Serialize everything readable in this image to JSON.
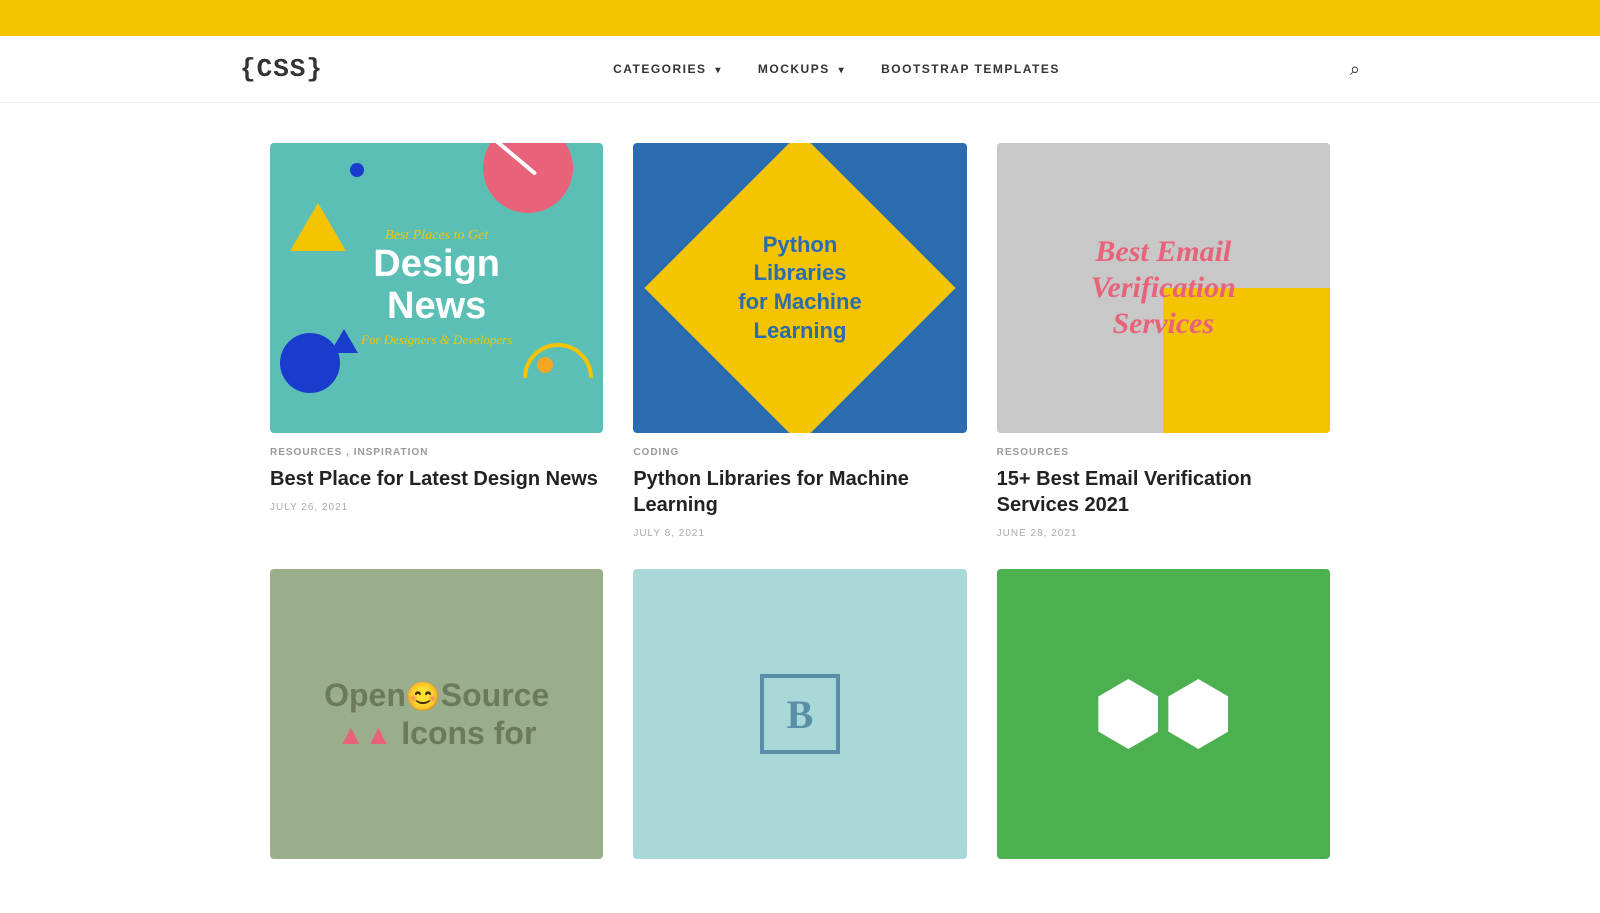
{
  "topbar": {
    "color": "#F5C400"
  },
  "navbar": {
    "logo": "{CSS}",
    "nav_items": [
      {
        "label": "CATEGORIES",
        "has_dropdown": true
      },
      {
        "label": "MOCKUPS",
        "has_dropdown": true
      },
      {
        "label": "BOOTSTRAP TEMPLATES",
        "has_dropdown": false
      }
    ],
    "search_label": "search"
  },
  "articles": [
    {
      "categories": [
        "RESOURCES",
        "INSPIRATION"
      ],
      "title": "Best Place for Latest Design News",
      "date": "JULY 26, 2021",
      "thumb_type": "design-news"
    },
    {
      "categories": [
        "CODING"
      ],
      "title": "Python Libraries for Machine Learning",
      "date": "JULY 8, 2021",
      "thumb_type": "python"
    },
    {
      "categories": [
        "RESOURCES"
      ],
      "title": "15+ Best Email Verification Services 2021",
      "date": "JUNE 28, 2021",
      "thumb_type": "email"
    }
  ],
  "bottom_articles": [
    {
      "thumb_type": "opensource",
      "text": "OpenSource Icons for"
    },
    {
      "thumb_type": "bootstrap",
      "text": "B"
    },
    {
      "thumb_type": "hexagon"
    }
  ],
  "card_texts": {
    "design_news": {
      "subtitle": "Best Places to Get",
      "title": "Design News",
      "tagline": "For Designers & Developers"
    },
    "python": {
      "text": "Python Libraries for Machine Learning"
    },
    "email": {
      "text": "Best Email Verification Services"
    }
  }
}
